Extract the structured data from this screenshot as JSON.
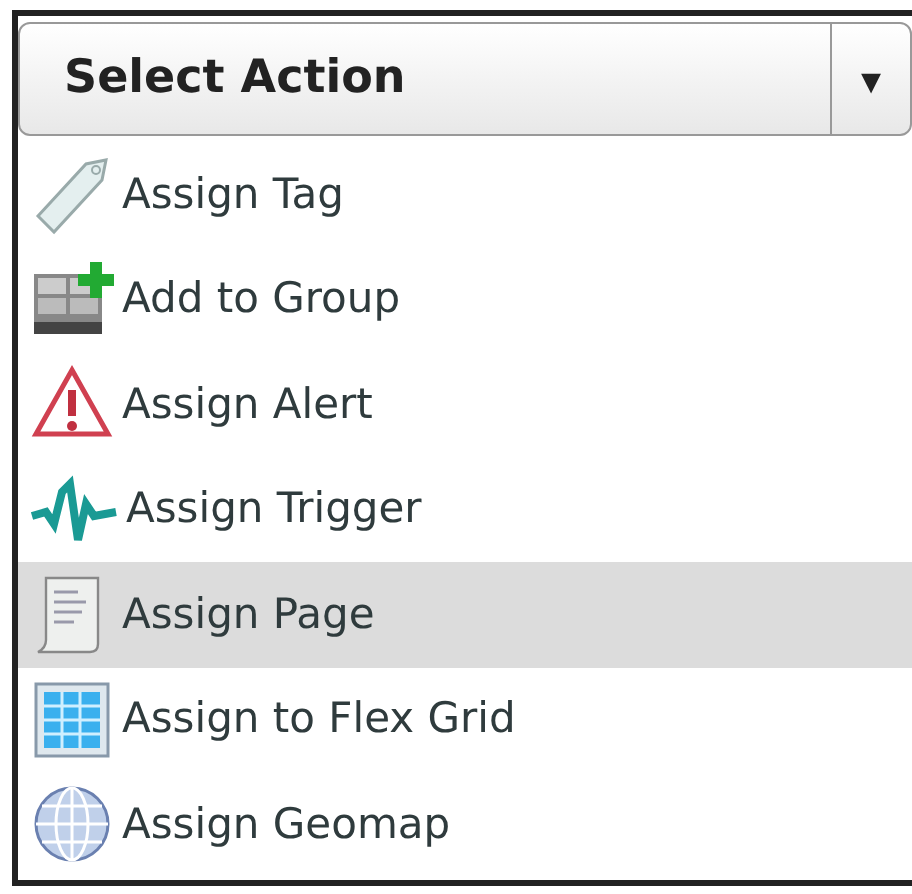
{
  "dropdown": {
    "label": "Select Action",
    "caret": "▾"
  },
  "items": [
    {
      "label": "Assign Tag",
      "selected": false
    },
    {
      "label": "Add to Group",
      "selected": false
    },
    {
      "label": "Assign Alert",
      "selected": false
    },
    {
      "label": "Assign Trigger",
      "selected": false
    },
    {
      "label": "Assign Page",
      "selected": true
    },
    {
      "label": "Assign to Flex Grid",
      "selected": false
    },
    {
      "label": "Assign Geomap",
      "selected": false
    }
  ]
}
